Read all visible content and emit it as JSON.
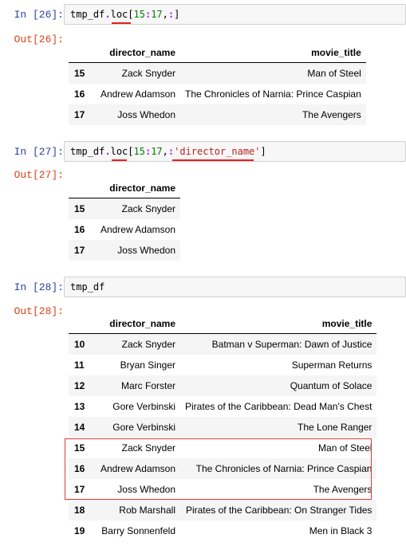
{
  "cells": [
    {
      "in_prompt": "In  [26]:",
      "out_prompt": "Out[26]:",
      "code": {
        "a": "tmp_df",
        "b": ".",
        "c": "loc",
        "d": "[",
        "e": "15",
        "f": ":",
        "g": "17",
        "h": ",",
        "i": ":",
        "j": "]"
      },
      "columns": [
        "director_name",
        "movie_title"
      ],
      "rows": [
        {
          "index": "15",
          "director_name": "Zack Snyder",
          "movie_title": "Man of Steel"
        },
        {
          "index": "16",
          "director_name": "Andrew Adamson",
          "movie_title": "The Chronicles of Narnia: Prince Caspian"
        },
        {
          "index": "17",
          "director_name": "Joss Whedon",
          "movie_title": "The Avengers"
        }
      ]
    },
    {
      "in_prompt": "In  [27]:",
      "out_prompt": "Out[27]:",
      "code": {
        "a": "tmp_df",
        "b": ".",
        "c": "loc",
        "d": "[",
        "e": "15",
        "f": ":",
        "g": "17",
        "h": ",",
        "i": ":",
        "s": "'director_name'",
        "j": "]"
      },
      "columns": [
        "director_name"
      ],
      "rows": [
        {
          "index": "15",
          "director_name": "Zack Snyder"
        },
        {
          "index": "16",
          "director_name": "Andrew Adamson"
        },
        {
          "index": "17",
          "director_name": "Joss Whedon"
        }
      ]
    },
    {
      "in_prompt": "In  [28]:",
      "out_prompt": "Out[28]:",
      "code": {
        "a": "tmp_df"
      },
      "columns": [
        "director_name",
        "movie_title"
      ],
      "rows": [
        {
          "index": "10",
          "director_name": "Zack Snyder",
          "movie_title": "Batman v Superman: Dawn of Justice"
        },
        {
          "index": "11",
          "director_name": "Bryan Singer",
          "movie_title": "Superman Returns"
        },
        {
          "index": "12",
          "director_name": "Marc Forster",
          "movie_title": "Quantum of Solace"
        },
        {
          "index": "13",
          "director_name": "Gore Verbinski",
          "movie_title": "Pirates of the Caribbean: Dead Man's Chest"
        },
        {
          "index": "14",
          "director_name": "Gore Verbinski",
          "movie_title": "The Lone Ranger"
        },
        {
          "index": "15",
          "director_name": "Zack Snyder",
          "movie_title": "Man of Steel"
        },
        {
          "index": "16",
          "director_name": "Andrew Adamson",
          "movie_title": "The Chronicles of Narnia: Prince Caspian"
        },
        {
          "index": "17",
          "director_name": "Joss Whedon",
          "movie_title": "The Avengers"
        },
        {
          "index": "18",
          "director_name": "Rob Marshall",
          "movie_title": "Pirates of the Caribbean: On Stranger Tides"
        },
        {
          "index": "19",
          "director_name": "Barry Sonnenfeld",
          "movie_title": "Men in Black 3"
        }
      ]
    }
  ],
  "colors": {
    "in_prompt": "#303F9F",
    "out_prompt": "#D84315",
    "highlight": "#e8201e"
  }
}
